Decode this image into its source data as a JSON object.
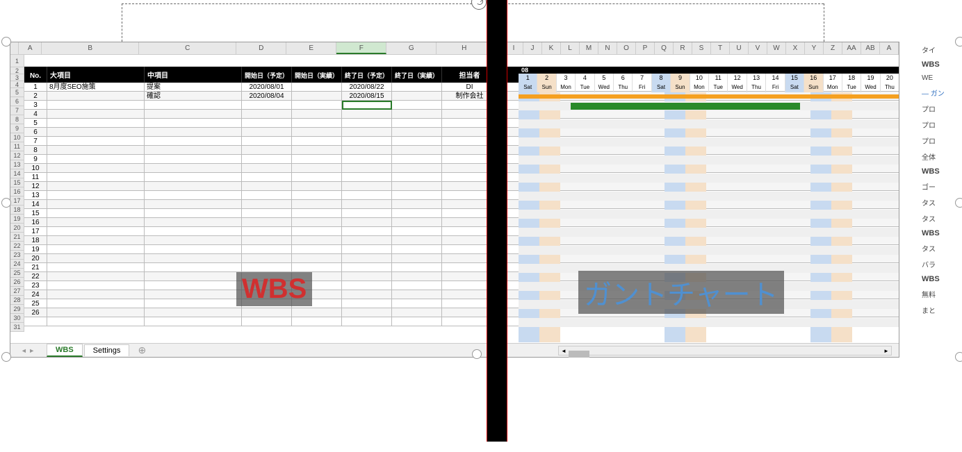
{
  "columns_left": [
    "A",
    "B",
    "C",
    "D",
    "E",
    "F",
    "G",
    "H"
  ],
  "columns_right": [
    "I",
    "J",
    "K",
    "L",
    "M",
    "N",
    "O",
    "P",
    "Q",
    "R",
    "S",
    "T",
    "U",
    "V",
    "W",
    "X",
    "Y",
    "Z",
    "AA",
    "AB",
    "A"
  ],
  "col_widths_left": [
    33,
    140,
    140,
    72,
    72,
    72,
    72,
    80
  ],
  "wbs_headers": {
    "no": "No.",
    "cat_major": "大項目",
    "cat_mid": "中項目",
    "start_plan": "開始日（予定）",
    "start_actual": "開始日（実績）",
    "end_plan": "終了日（予定）",
    "end_actual": "終了日（実績）",
    "assignee": "担当者"
  },
  "rows": [
    {
      "no": "1",
      "major": "8月度SEO施策",
      "mid": "提案",
      "sp": "2020/08/01",
      "sa": "",
      "ep": "2020/08/22",
      "ea": "",
      "asg": "DI"
    },
    {
      "no": "2",
      "major": "",
      "mid": "確認",
      "sp": "2020/08/04",
      "sa": "",
      "ep": "2020/08/15",
      "ea": "",
      "asg": "制作会社"
    },
    {
      "no": "3"
    },
    {
      "no": "4"
    },
    {
      "no": "5"
    },
    {
      "no": "6"
    },
    {
      "no": "7"
    },
    {
      "no": "8"
    },
    {
      "no": "9"
    },
    {
      "no": "10"
    },
    {
      "no": "11"
    },
    {
      "no": "12"
    },
    {
      "no": "13"
    },
    {
      "no": "14"
    },
    {
      "no": "15"
    },
    {
      "no": "16"
    },
    {
      "no": "17"
    },
    {
      "no": "18"
    },
    {
      "no": "19"
    },
    {
      "no": "20"
    },
    {
      "no": "21"
    },
    {
      "no": "22"
    },
    {
      "no": "23"
    },
    {
      "no": "24"
    },
    {
      "no": "25"
    },
    {
      "no": "26"
    },
    {
      "no": ""
    }
  ],
  "row_numbers": [
    "1",
    "2",
    "3",
    "4",
    "5",
    "6",
    "7",
    "8",
    "9",
    "10",
    "11",
    "12",
    "13",
    "14",
    "15",
    "16",
    "17",
    "18",
    "19",
    "20",
    "21",
    "22",
    "23",
    "24",
    "25",
    "26",
    "27",
    "28",
    "29",
    "30",
    "31"
  ],
  "gantt": {
    "month": "08",
    "days": [
      {
        "d": "1",
        "w": "Sat",
        "t": "sat"
      },
      {
        "d": "2",
        "w": "Sun",
        "t": "sun"
      },
      {
        "d": "3",
        "w": "Mon",
        "t": ""
      },
      {
        "d": "4",
        "w": "Tue",
        "t": ""
      },
      {
        "d": "5",
        "w": "Wed",
        "t": ""
      },
      {
        "d": "6",
        "w": "Thu",
        "t": ""
      },
      {
        "d": "7",
        "w": "Fri",
        "t": ""
      },
      {
        "d": "8",
        "w": "Sat",
        "t": "sat"
      },
      {
        "d": "9",
        "w": "Sun",
        "t": "sun"
      },
      {
        "d": "10",
        "w": "Mon",
        "t": ""
      },
      {
        "d": "11",
        "w": "Tue",
        "t": ""
      },
      {
        "d": "12",
        "w": "Wed",
        "t": ""
      },
      {
        "d": "13",
        "w": "Thu",
        "t": ""
      },
      {
        "d": "14",
        "w": "Fri",
        "t": ""
      },
      {
        "d": "15",
        "w": "Sat",
        "t": "sat"
      },
      {
        "d": "16",
        "w": "Sun",
        "t": "sun"
      },
      {
        "d": "17",
        "w": "Mon",
        "t": ""
      },
      {
        "d": "18",
        "w": "Tue",
        "t": ""
      },
      {
        "d": "19",
        "w": "Wed",
        "t": ""
      },
      {
        "d": "20",
        "w": "Thu",
        "t": ""
      }
    ]
  },
  "labels": {
    "wbs": "WBS",
    "gantt": "ガントチャート"
  },
  "tabs": {
    "wbs": "WBS",
    "settings": "Settings"
  },
  "side": [
    "タイ",
    "WBS",
    "WE",
    "ガン",
    "プロ",
    "プロ",
    "プロ",
    "全体",
    "WBS",
    "ゴー",
    "タス",
    "タス",
    "WBS",
    "タス",
    "バラ",
    "WBS",
    "無料",
    "まと"
  ],
  "side_bold": [
    1,
    8,
    12,
    15
  ],
  "side_blue_idx": 3
}
